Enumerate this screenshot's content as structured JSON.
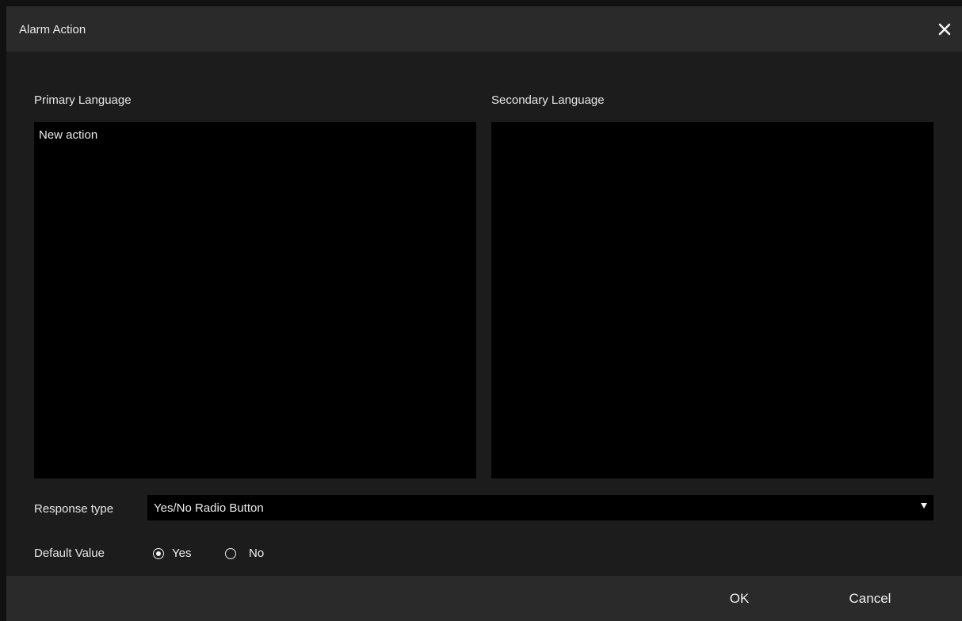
{
  "dialog": {
    "title": "Alarm Action",
    "close_icon": "close-icon"
  },
  "primary": {
    "label": "Primary Language",
    "value": "New action"
  },
  "secondary": {
    "label": "Secondary Language",
    "value": ""
  },
  "response_type": {
    "label": "Response type",
    "selected": "Yes/No Radio Button",
    "arrow_icon": "dropdown-arrow-icon"
  },
  "default_value": {
    "label": "Default Value",
    "options": [
      {
        "label": "Yes",
        "checked": true
      },
      {
        "label": "No",
        "checked": false
      }
    ]
  },
  "footer": {
    "ok_label": "OK",
    "cancel_label": "Cancel"
  },
  "colors": {
    "title_bar": "#2a2a2a",
    "body": "#1c1c1c",
    "field": "#000000",
    "text": "#e6e6e6"
  }
}
